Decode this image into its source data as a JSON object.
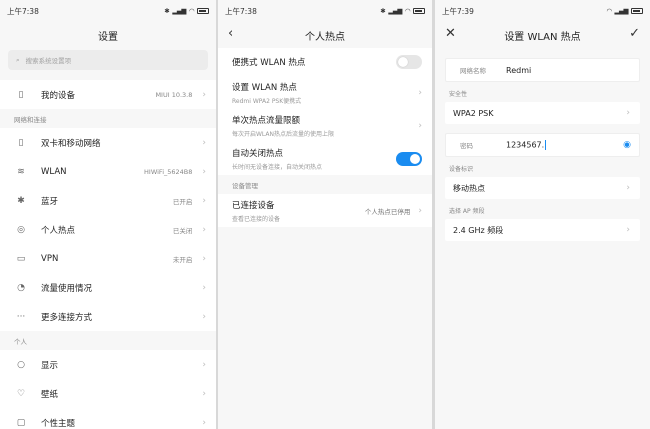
{
  "screen1": {
    "status_time": "上午7:38",
    "title": "设置",
    "search_placeholder": "搜索系统设置项",
    "my_device": {
      "label": "我的设备",
      "value": "MIUI 10.3.8"
    },
    "section_network": "网络和连接",
    "network_items": [
      {
        "label": "双卡和移动网络",
        "value": ""
      },
      {
        "label": "WLAN",
        "value": "HIWiFi_5624B8"
      },
      {
        "label": "蓝牙",
        "value": "已开启"
      },
      {
        "label": "个人热点",
        "value": "已关闭"
      },
      {
        "label": "VPN",
        "value": "未开启"
      },
      {
        "label": "流量使用情况",
        "value": ""
      },
      {
        "label": "更多连接方式",
        "value": ""
      }
    ],
    "section_personal": "个人",
    "personal_items": [
      {
        "label": "显示"
      },
      {
        "label": "壁纸"
      },
      {
        "label": "个性主题"
      }
    ]
  },
  "screen2": {
    "status_time": "上午7:38",
    "title": "个人热点",
    "portable": "便携式 WLAN 热点",
    "setup": {
      "title": "设置 WLAN 热点",
      "sub": "Redmi WPA2 PSK便携式"
    },
    "limit": {
      "title": "单次热点流量限额",
      "sub": "每次开启WLAN热点后流量的使用上限"
    },
    "autooff": {
      "title": "自动关闭热点",
      "sub": "长时间无设备连接，自动关闭热点"
    },
    "section_device": "设备管理",
    "connected": {
      "title": "已连接设备",
      "sub": "查看已连接的设备",
      "value": "个人热点已停用"
    }
  },
  "screen3": {
    "status_time": "上午7:39",
    "title": "设置 WLAN 热点",
    "network_name_label": "网络名称",
    "network_name_value": "Redmi",
    "security_label": "安全性",
    "security_value": "WPA2 PSK",
    "password_label": "密码",
    "password_value": "1234567.",
    "device_id_label": "设备标识",
    "device_id_value": "移动热点",
    "ap_band_label": "选择 AP 频段",
    "ap_band_value": "2.4 GHz 频段"
  },
  "colors": {
    "accent": "#1a8cf0"
  }
}
